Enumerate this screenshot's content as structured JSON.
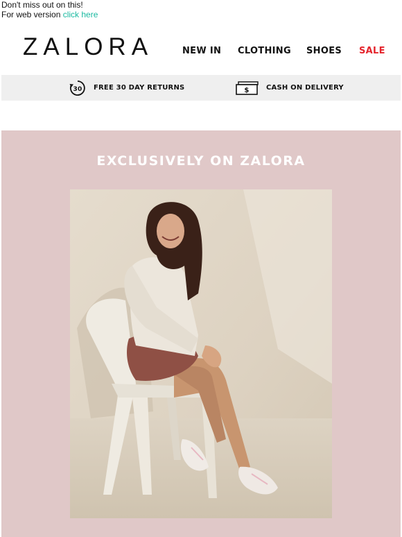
{
  "preheader": {
    "line1": "Don't miss out on this!",
    "line2_prefix": "For web version ",
    "link_text": "click here"
  },
  "header": {
    "logo": "ZALORA",
    "nav": [
      "NEW IN",
      "CLOTHING",
      "SHOES",
      "SALE"
    ]
  },
  "benefits": {
    "returns_icon_text": "30",
    "returns_label": "FREE 30 DAY RETURNS",
    "cod_icon_text": "$",
    "cod_label": "CASH ON DELIVERY"
  },
  "hero": {
    "title": "EXCLUSIVELY ON ZALORA"
  },
  "colors": {
    "link": "#19b9a0",
    "sale": "#e4242c",
    "hero_background": "#e0c8c8",
    "benefits_bar": "#efefef"
  }
}
